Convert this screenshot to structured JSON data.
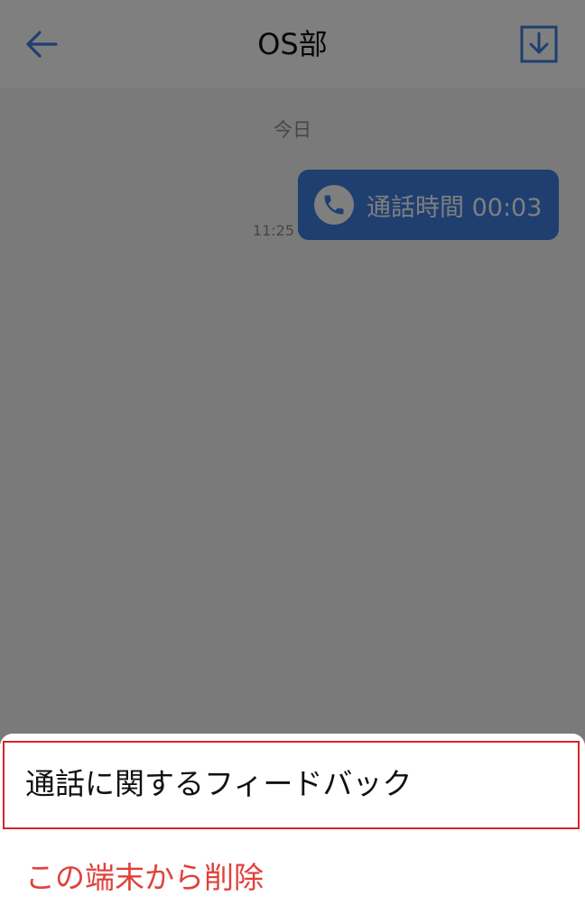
{
  "header": {
    "title": "OS部",
    "back_icon": "arrow-left-icon",
    "download_icon": "download-icon"
  },
  "chat": {
    "date_separator": "今日",
    "messages": [
      {
        "type": "call",
        "icon": "phone-icon",
        "text": "通話時間 00:03",
        "time": "11:25"
      }
    ]
  },
  "sheet": {
    "items": [
      {
        "label": "通話に関するフィードバック",
        "highlighted": true
      },
      {
        "label": "この端末から削除",
        "destructive": true
      }
    ]
  },
  "colors": {
    "accent": "#3d7ee0",
    "destructive": "#e0403a",
    "highlight_border": "#d8232a"
  }
}
